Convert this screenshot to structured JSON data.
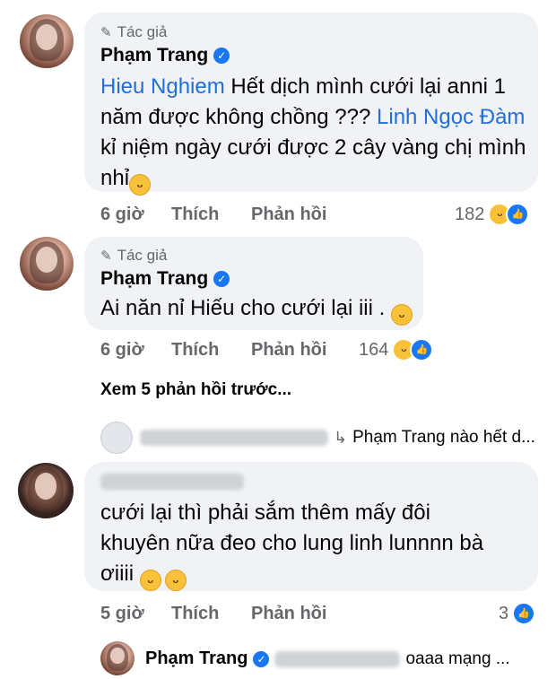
{
  "comments": [
    {
      "author_tag": "Tác giả",
      "name": "Phạm Trang",
      "mention1": "Hieu Nghiem",
      "text1": " Hết dịch mình cưới lại anni 1 năm được không chồng ??? ",
      "mention2": "Linh Ngọc Đàm",
      "text2": " kỉ niệm ngày cưới được 2 cây vàng chị mình nhỉ",
      "time": "6 giờ",
      "like": "Thích",
      "reply": "Phản hồi",
      "reaction_count": "182"
    },
    {
      "author_tag": "Tác giả",
      "name": "Phạm Trang",
      "text": "Ai năn nỉ Hiếu cho cưới lại iii .",
      "time": "6 giờ",
      "like": "Thích",
      "reply": "Phản hồi",
      "reaction_count": "164"
    },
    {
      "text": "cưới lại thì phải sắm thêm mấy đôi khuyên nữa đeo cho lung linh lunnnn bà ơiiii",
      "time": "5 giờ",
      "like": "Thích",
      "reply": "Phản hồi",
      "reaction_count": "3"
    }
  ],
  "more_replies": "Xem 5 phản hồi trước...",
  "preview_reply": {
    "text": "Phạm Trang nào hết d..."
  },
  "last_reply": {
    "name": "Phạm Trang",
    "text": "oaaa mạng ..."
  },
  "icons": {
    "verified": "verified-check-icon",
    "pen": "pen-icon",
    "haha": "haha-emoji-icon",
    "like": "like-reaction-icon",
    "reply_arrow": "reply-arrow-icon"
  },
  "colors": {
    "bubble": "#f0f2f5",
    "mention": "#216fdb",
    "verified": "#1877f2",
    "secondary_text": "#65676b"
  }
}
